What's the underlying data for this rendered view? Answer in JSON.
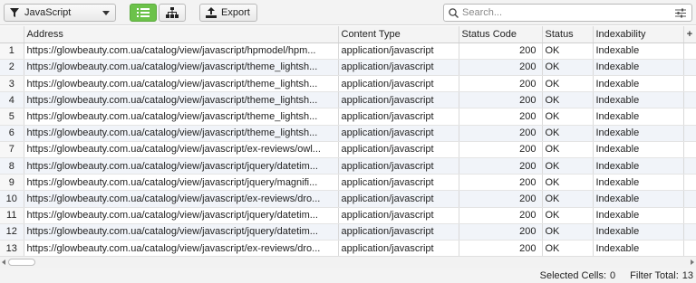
{
  "toolbar": {
    "filter_value": "JavaScript",
    "export_label": "Export",
    "search_placeholder": "Search..."
  },
  "columns": {
    "address": "Address",
    "content_type": "Content Type",
    "status_code": "Status Code",
    "status": "Status",
    "indexability": "Indexability",
    "add": "+"
  },
  "rows": [
    {
      "n": "1",
      "address": "https://glowbeauty.com.ua/catalog/view/javascript/hpmodel/hpm...",
      "type": "application/javascript",
      "code": "200",
      "status": "OK",
      "idx": "Indexable"
    },
    {
      "n": "2",
      "address": "https://glowbeauty.com.ua/catalog/view/javascript/theme_lightsh...",
      "type": "application/javascript",
      "code": "200",
      "status": "OK",
      "idx": "Indexable"
    },
    {
      "n": "3",
      "address": "https://glowbeauty.com.ua/catalog/view/javascript/theme_lightsh...",
      "type": "application/javascript",
      "code": "200",
      "status": "OK",
      "idx": "Indexable"
    },
    {
      "n": "4",
      "address": "https://glowbeauty.com.ua/catalog/view/javascript/theme_lightsh...",
      "type": "application/javascript",
      "code": "200",
      "status": "OK",
      "idx": "Indexable"
    },
    {
      "n": "5",
      "address": "https://glowbeauty.com.ua/catalog/view/javascript/theme_lightsh...",
      "type": "application/javascript",
      "code": "200",
      "status": "OK",
      "idx": "Indexable"
    },
    {
      "n": "6",
      "address": "https://glowbeauty.com.ua/catalog/view/javascript/theme_lightsh...",
      "type": "application/javascript",
      "code": "200",
      "status": "OK",
      "idx": "Indexable"
    },
    {
      "n": "7",
      "address": "https://glowbeauty.com.ua/catalog/view/javascript/ex-reviews/owl...",
      "type": "application/javascript",
      "code": "200",
      "status": "OK",
      "idx": "Indexable"
    },
    {
      "n": "8",
      "address": "https://glowbeauty.com.ua/catalog/view/javascript/jquery/datetim...",
      "type": "application/javascript",
      "code": "200",
      "status": "OK",
      "idx": "Indexable"
    },
    {
      "n": "9",
      "address": "https://glowbeauty.com.ua/catalog/view/javascript/jquery/magnifi...",
      "type": "application/javascript",
      "code": "200",
      "status": "OK",
      "idx": "Indexable"
    },
    {
      "n": "10",
      "address": "https://glowbeauty.com.ua/catalog/view/javascript/ex-reviews/dro...",
      "type": "application/javascript",
      "code": "200",
      "status": "OK",
      "idx": "Indexable"
    },
    {
      "n": "11",
      "address": "https://glowbeauty.com.ua/catalog/view/javascript/jquery/datetim...",
      "type": "application/javascript",
      "code": "200",
      "status": "OK",
      "idx": "Indexable"
    },
    {
      "n": "12",
      "address": "https://glowbeauty.com.ua/catalog/view/javascript/jquery/datetim...",
      "type": "application/javascript",
      "code": "200",
      "status": "OK",
      "idx": "Indexable"
    },
    {
      "n": "13",
      "address": "https://glowbeauty.com.ua/catalog/view/javascript/ex-reviews/dro...",
      "type": "application/javascript",
      "code": "200",
      "status": "OK",
      "idx": "Indexable"
    }
  ],
  "statusbar": {
    "selected_label": "Selected Cells:",
    "selected_value": "0",
    "filter_label": "Filter Total:",
    "filter_value": "13"
  },
  "colors": {
    "accent_green": "#6cc24a",
    "row_stripe": "#f1f4f9"
  },
  "icons": {
    "filter": "funnel-icon",
    "list_view": "list-view-icon",
    "tree_view": "tree-view-icon",
    "export": "export-icon",
    "search": "search-icon",
    "search_settings": "sliders-icon"
  }
}
